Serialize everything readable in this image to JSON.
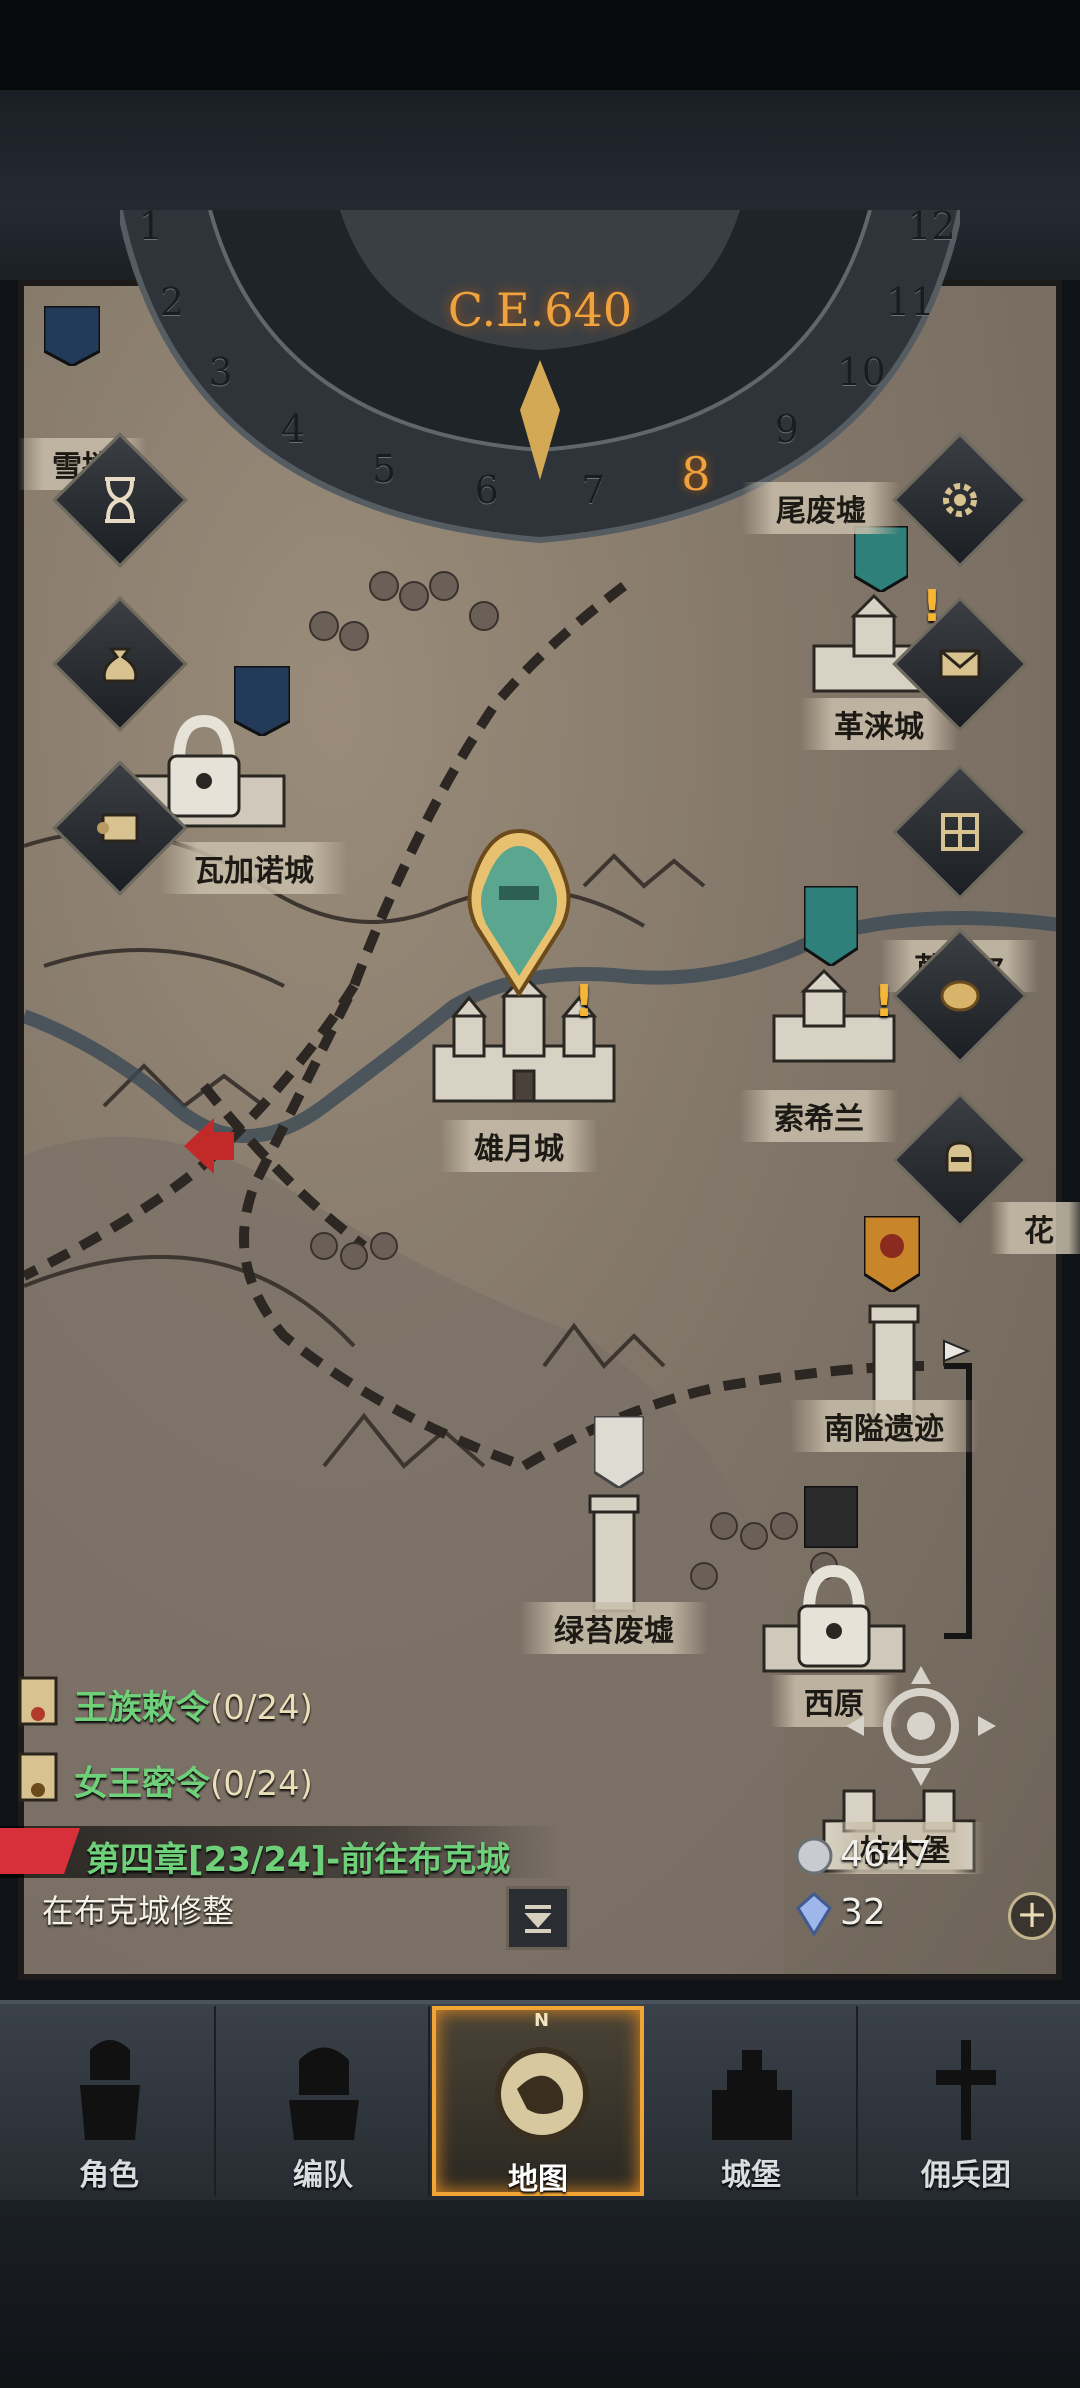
{
  "era": {
    "label": "C.E.640",
    "current_month": "8",
    "months": [
      "1",
      "2",
      "3",
      "4",
      "5",
      "6",
      "7",
      "8",
      "9",
      "10",
      "11",
      "12"
    ]
  },
  "cities": {
    "xuetian": "雪捲",
    "weiwei": "尾废墟",
    "gelai": "革涞城",
    "wajianuo": "瓦加诺城",
    "mulan": "莨莱尔",
    "xiongyue": "雄月城",
    "suoxilan": "索希兰",
    "hua": "花",
    "nanyi": "南隘遗迹",
    "lvtai": "绿苔废墟",
    "xiyuan": "西原",
    "kumu": "枯木堡"
  },
  "quests": [
    {
      "title": "王族敕令",
      "progress": "(0/24)"
    },
    {
      "title": "女王密令",
      "progress": "(0/24)"
    }
  ],
  "chapter": {
    "text": "第四章[23/24]-前往布克城",
    "subtask": "在布克城修整"
  },
  "currency": {
    "silver": "4647",
    "crystal": "32"
  },
  "nav": {
    "items": [
      "角色",
      "编队",
      "地图",
      "城堡",
      "佣兵团"
    ],
    "active": "地图",
    "compass_n": "N"
  },
  "colors": {
    "accent": "#f0a536",
    "quest_green": "#6fd07a",
    "era_orange": "#f0a23c"
  },
  "icons": [
    "hourglass-icon",
    "treasure-bag-icon",
    "scroll-icon",
    "gear-icon",
    "mail-icon",
    "inventory-icon",
    "coin-icon",
    "knight-helmet-icon",
    "locate-icon",
    "silver-coin-icon",
    "crystal-icon",
    "plus-icon"
  ]
}
